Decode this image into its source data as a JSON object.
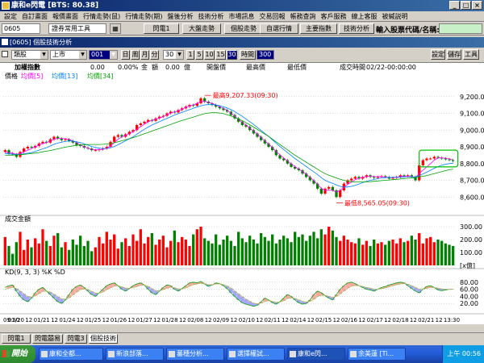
{
  "window": {
    "title": "康和e閃電 [BTS: 80.38]",
    "min": "_",
    "max": "□",
    "close": "×"
  },
  "menu": [
    "設定",
    "自訂畫面",
    "報價畫面",
    "行情走勢(鼠)",
    "行情走勢(期)",
    "盤後分析",
    "技術分析",
    "市場訊息",
    "交易回報",
    "帳務查詢",
    "客戶服務",
    "線上客服",
    "被緘説明"
  ],
  "toolbar": {
    "stock_code": "0605",
    "tool_group": "證券常用工具",
    "buttons": [
      "閃電1",
      "大盤走勢",
      "個股走勢",
      "自選行情",
      "主要指數",
      "技術分析"
    ],
    "search_label": "輸入股票代碼/名稱:",
    "search_value": ""
  },
  "child": {
    "title": "[0605] 個股技術分析",
    "type_select": "類股",
    "market_select": "上市",
    "code_select": "001",
    "periods": [
      "日",
      "周",
      "月",
      "分"
    ],
    "interval_select": "30",
    "minutes": [
      "1",
      "5",
      "10",
      "15",
      "30"
    ],
    "time_label": "時間",
    "count_value": "300",
    "right_buttons": [
      "設定",
      "儲存",
      "工具"
    ]
  },
  "info": {
    "name": "加權指數",
    "change": "0.00",
    "pct": "0.00%",
    "amount_label": "金",
    "amount_value": "額",
    "price": "0.00",
    "volume_label": "億",
    "open_label": "開盤價",
    "high_label": "最高價",
    "low_label": "最低價",
    "time_label": "成交時間",
    "time_value": "02/22-00:00:00"
  },
  "chart_data": {
    "type": "line",
    "price_legend": [
      "價格",
      "均價[5]",
      "均價[13]",
      "均價[34]"
    ],
    "price_ylim": [
      8500,
      9300
    ],
    "price_ticks": [
      "9,200.00",
      "9,100.00",
      "9,000.00",
      "8,900.00",
      "8,800.00",
      "8,700.00",
      "8,600.00"
    ],
    "annotations": [
      {
        "text": "最高9,207.33(09:30)",
        "x_index": 53,
        "value": 9207.33
      },
      {
        "text": "最低8,565.05(09:30)",
        "x_index": 88,
        "value": 8565.05
      }
    ],
    "close": [
      8880,
      8860,
      8855,
      8840,
      8870,
      8890,
      8900,
      8895,
      8905,
      8920,
      8930,
      8925,
      8945,
      8960,
      8950,
      8940,
      8945,
      8935,
      8925,
      8910,
      8905,
      8895,
      8890,
      8880,
      8880,
      8885,
      8890,
      8900,
      8930,
      8960,
      8970,
      8960,
      8975,
      8990,
      9000,
      9030,
      9040,
      9050,
      9060,
      9055,
      9070,
      9080,
      9085,
      9100,
      9110,
      9105,
      9120,
      9130,
      9140,
      9150,
      9145,
      9160,
      9190,
      9170,
      9160,
      9150,
      9140,
      9130,
      9120,
      9110,
      9090,
      9070,
      9050,
      9030,
      9020,
      9000,
      8980,
      8960,
      8940,
      8920,
      8900,
      8880,
      8850,
      8830,
      8820,
      8800,
      8780,
      8770,
      8760,
      8740,
      8720,
      8700,
      8680,
      8650,
      8620,
      8650,
      8660,
      8640,
      8600,
      8640,
      8680,
      8700,
      8710,
      8720,
      8710,
      8720,
      8730,
      8720,
      8715,
      8720,
      8725,
      8720,
      8710,
      8715,
      8720,
      8730,
      8725,
      8730,
      8720,
      8700,
      8790,
      8820,
      8830,
      8830,
      8840,
      8835,
      8830,
      8825,
      8820,
      8815
    ],
    "ma5": [
      8870,
      8865,
      8862,
      8855,
      8860,
      8870,
      8880,
      8890,
      8900,
      8910,
      8920,
      8925,
      8935,
      8945,
      8950,
      8950,
      8948,
      8945,
      8935,
      8925,
      8910,
      8900,
      8892,
      8885,
      8882,
      8882,
      8885,
      8892,
      8905,
      8925,
      8945,
      8960,
      8968,
      8978,
      8990,
      9005,
      9020,
      9035,
      9050,
      9058,
      9065,
      9072,
      9080,
      9092,
      9102,
      9108,
      9115,
      9125,
      9135,
      9145,
      9150,
      9160,
      9170,
      9172,
      9165,
      9160,
      9150,
      9140,
      9130,
      9118,
      9100,
      9082,
      9064,
      9046,
      9030,
      9012,
      8994,
      8976,
      8956,
      8936,
      8916,
      8896,
      8872,
      8852,
      8834,
      8816,
      8798,
      8782,
      8768,
      8752,
      8736,
      8718,
      8698,
      8676,
      8652,
      8640,
      8640,
      8640,
      8630,
      8640,
      8656,
      8676,
      8690,
      8704,
      8712,
      8718,
      8722,
      8724,
      8722,
      8721,
      8722,
      8720,
      8716,
      8716,
      8718,
      8722,
      8724,
      8726,
      8722,
      8716,
      8740,
      8760,
      8780,
      8800,
      8820,
      8834,
      8834,
      8832,
      8828,
      8822
    ],
    "ma13": [
      8860,
      8858,
      8856,
      8854,
      8855,
      8858,
      8862,
      8866,
      8872,
      8880,
      8888,
      8895,
      8905,
      8915,
      8922,
      8928,
      8932,
      8935,
      8934,
      8930,
      8925,
      8918,
      8910,
      8902,
      8896,
      8892,
      8890,
      8890,
      8894,
      8902,
      8912,
      8924,
      8936,
      8948,
      8960,
      8975,
      8990,
      9005,
      9018,
      9030,
      9040,
      9050,
      9060,
      9070,
      9080,
      9090,
      9098,
      9106,
      9114,
      9122,
      9130,
      9138,
      9145,
      9150,
      9152,
      9152,
      9150,
      9146,
      9140,
      9132,
      9122,
      9110,
      9096,
      9082,
      9066,
      9050,
      9034,
      9016,
      8998,
      8980,
      8962,
      8942,
      8922,
      8902,
      8884,
      8866,
      8848,
      8830,
      8814,
      8798,
      8782,
      8766,
      8750,
      8734,
      8716,
      8700,
      8690,
      8682,
      8672,
      8664,
      8660,
      8660,
      8664,
      8670,
      8678,
      8686,
      8694,
      8700,
      8705,
      8710,
      8714,
      8716,
      8717,
      8718,
      8718,
      8719,
      8720,
      8721,
      8721,
      8720,
      8728,
      8738,
      8748,
      8760,
      8772,
      8782,
      8790,
      8796,
      8800,
      8802
    ],
    "ma34": [
      8850,
      8850,
      8851,
      8852,
      8853,
      8855,
      8857,
      8860,
      8863,
      8866,
      8870,
      8874,
      8878,
      8883,
      8888,
      8893,
      8898,
      8902,
      8906,
      8909,
      8911,
      8913,
      8914,
      8914,
      8914,
      8914,
      8915,
      8917,
      8920,
      8925,
      8930,
      8936,
      8942,
      8948,
      8955,
      8962,
      8970,
      8978,
      8986,
      8994,
      9002,
      9010,
      9018,
      9026,
      9034,
      9042,
      9050,
      9057,
      9064,
      9071,
      9078,
      9085,
      9092,
      9098,
      9102,
      9104,
      9104,
      9102,
      9098,
      9092,
      9084,
      9076,
      9066,
      9056,
      9044,
      9032,
      9018,
      9004,
      8990,
      8976,
      8962,
      8946,
      8930,
      8914,
      8898,
      8882,
      8866,
      8850,
      8836,
      8822,
      8808,
      8794,
      8780,
      8766,
      8752,
      8740,
      8730,
      8722,
      8714,
      8706,
      8700,
      8695,
      8692,
      8690,
      8690,
      8690,
      8691,
      8692,
      8694,
      8696,
      8698,
      8700,
      8702,
      8704,
      8706,
      8708,
      8710,
      8712,
      8714,
      8716,
      8720,
      8724,
      8728,
      8734,
      8740,
      8746,
      8752,
      8758,
      8763,
      8767
    ],
    "volume_title": "成交金額",
    "volume_ylim": [
      0,
      350
    ],
    "volume_ticks": [
      "300.00",
      "200.00",
      "100.00"
    ],
    "volume_unit": "[x億]",
    "volume": [
      220,
      150,
      90,
      180,
      260,
      120,
      200,
      140,
      210,
      170,
      280,
      190,
      150,
      230,
      250,
      140,
      180,
      120,
      200,
      160,
      230,
      150,
      190,
      110,
      140,
      220,
      170,
      260,
      200,
      240,
      130,
      180,
      210,
      150,
      240,
      190,
      280,
      170,
      220,
      250,
      160,
      200,
      230,
      140,
      190,
      270,
      180,
      220,
      200,
      150,
      240,
      280,
      300,
      210,
      190,
      170,
      240,
      160,
      200,
      230,
      190,
      150,
      260,
      210,
      180,
      230,
      200,
      170,
      250,
      220,
      190,
      240,
      170,
      200,
      230,
      210,
      180,
      260,
      220,
      240,
      190,
      230,
      260,
      210,
      280,
      240,
      300,
      270,
      220,
      190,
      230,
      200,
      180,
      170,
      210,
      160,
      190,
      150,
      200,
      170,
      180,
      160,
      190,
      200,
      170,
      210,
      180,
      190,
      230,
      200,
      250,
      170,
      210,
      220,
      180,
      200,
      190,
      170,
      160,
      150
    ],
    "kd_title": "KD(9, 3, 3) %K %D",
    "kd_ylim": [
      0,
      100
    ],
    "kd_ticks": [
      "80.00",
      "60.00",
      "40.00",
      "20.00"
    ],
    "k": [
      65,
      70,
      72,
      55,
      40,
      30,
      25,
      35,
      50,
      60,
      65,
      55,
      45,
      35,
      25,
      20,
      30,
      45,
      60,
      68,
      72,
      65,
      55,
      45,
      40,
      50,
      60,
      70,
      75,
      78,
      70,
      60,
      55,
      62,
      70,
      75,
      78,
      72,
      60,
      50,
      45,
      55,
      65,
      72,
      70,
      60,
      55,
      62,
      70,
      78,
      80,
      78,
      82,
      75,
      68,
      72,
      78,
      76,
      70,
      62,
      50,
      40,
      30,
      22,
      18,
      15,
      12,
      15,
      25,
      35,
      30,
      22,
      18,
      25,
      35,
      45,
      40,
      30,
      22,
      18,
      20,
      30,
      45,
      55,
      50,
      42,
      35,
      30,
      45,
      60,
      70,
      78,
      80,
      76,
      70,
      65,
      60,
      58,
      55,
      60,
      65,
      68,
      72,
      75,
      78,
      80,
      78,
      70,
      62,
      55,
      50,
      60,
      68,
      70,
      65,
      58,
      56,
      58,
      60,
      60
    ],
    "d": [
      60,
      63,
      66,
      62,
      55,
      47,
      40,
      38,
      42,
      48,
      54,
      55,
      52,
      46,
      39,
      33,
      32,
      36,
      44,
      52,
      59,
      61,
      59,
      54,
      49,
      49,
      53,
      59,
      64,
      69,
      70,
      67,
      63,
      63,
      65,
      68,
      71,
      72,
      68,
      62,
      56,
      56,
      59,
      63,
      66,
      64,
      61,
      61,
      64,
      69,
      73,
      75,
      77,
      76,
      73,
      73,
      75,
      75,
      73,
      69,
      63,
      55,
      47,
      39,
      32,
      26,
      21,
      19,
      21,
      26,
      28,
      26,
      23,
      24,
      28,
      34,
      36,
      34,
      30,
      26,
      24,
      26,
      32,
      40,
      43,
      43,
      40,
      37,
      40,
      47,
      55,
      63,
      69,
      71,
      70,
      68,
      65,
      63,
      60,
      60,
      62,
      64,
      67,
      70,
      73,
      75,
      76,
      74,
      70,
      65,
      60,
      60,
      63,
      65,
      65,
      63,
      61,
      60,
      60,
      60
    ],
    "x_ticks": [
      "09:30",
      "01/20",
      "12",
      "01/21",
      "12",
      "01/24",
      "12",
      "01/25",
      "12",
      "01/26",
      "12",
      "01/27",
      "12",
      "01/28",
      "12",
      "02/08",
      "12",
      "02/09",
      "12",
      "02/10",
      "12",
      "02/11",
      "12",
      "02/14",
      "12",
      "02/15",
      "12",
      "02/16",
      "12",
      "02/17",
      "12",
      "02/18",
      "12",
      "02/21",
      "12",
      "13:30"
    ],
    "colors": {
      "up": "#ff0000",
      "down": "#008000",
      "ma5": "#ff00ff",
      "ma13": "#0080ff",
      "ma34": "#00a000",
      "k": "#00a000",
      "d": "#b0b060",
      "annot": "#ff0000",
      "highlight": "#00c000"
    }
  },
  "bottom_tabs": [
    "閃電1",
    "閃電囍易",
    "閃電3",
    "個股技術"
  ],
  "taskbar": {
    "start": "開始",
    "items": [
      "康和全都...",
      "新浪部落...",
      "蕃穗分析...",
      "選擇權試...",
      "康和e閃...",
      "余美蓮 [Ti..."
    ],
    "clock": "上午 00:56"
  }
}
